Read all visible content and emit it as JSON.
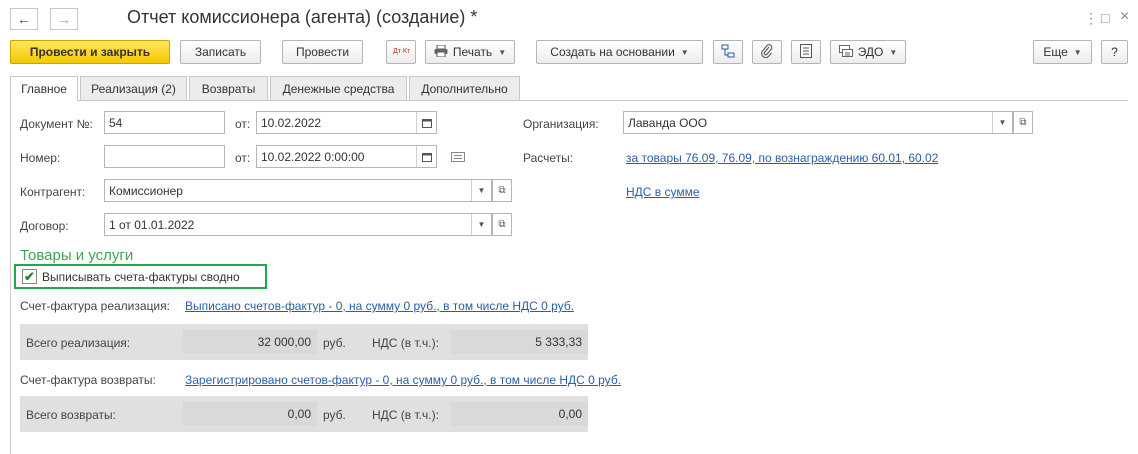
{
  "window": {
    "title": "Отчет комиссионера (агента) (создание) *",
    "back_icon": "←",
    "forward_icon": "→",
    "menu_icon": "⋮",
    "maximize_icon": "□",
    "close_icon": "×"
  },
  "toolbar": {
    "post_close": "Провести и закрыть",
    "save": "Записать",
    "post": "Провести",
    "dtkt": "Дт Кт",
    "print": "Печать",
    "create_based": "Создать на основании",
    "edo": "ЭДО",
    "more": "Еще",
    "help": "?"
  },
  "tabs": [
    {
      "label": "Главное"
    },
    {
      "label": "Реализация (2)"
    },
    {
      "label": "Возвраты"
    },
    {
      "label": "Денежные средства"
    },
    {
      "label": "Дополнительно"
    }
  ],
  "form": {
    "doc_no_label": "Документ №:",
    "doc_no_value": "54",
    "from_label": "от:",
    "doc_date": "10.02.2022",
    "number_label": "Номер:",
    "number_value": "",
    "datetime": "10.02.2022  0:00:00",
    "counterparty_label": "Контрагент:",
    "counterparty_value": "Комиссионер",
    "contract_label": "Договор:",
    "contract_value": "1 от 01.01.2022",
    "org_label": "Организация:",
    "org_value": "Лаванда ООО",
    "settlements_label": "Расчеты:",
    "settlements_link": "за товары 76.09, 76.09, по вознаграждению 60.01, 60.02",
    "vat_link": "НДС в сумме"
  },
  "goods": {
    "section_title": "Товары и услуги",
    "checkbox_label": "Выписывать счета-фактуры сводно",
    "checkbox_checked": true,
    "invoice_sales_label": "Счет-фактура реализация:",
    "invoice_sales_link": "Выписано счетов-фактур - 0, на сумму 0 руб., в том числе НДС 0 руб.",
    "total_sales_label": "Всего реализация:",
    "total_sales_value": "32 000,00",
    "currency1": "руб.",
    "vat_incl_label1": "НДС (в т.ч.):",
    "vat_sales_value": "5 333,33",
    "invoice_returns_label": "Счет-фактура возвраты:",
    "invoice_returns_link": "Зарегистрировано счетов-фактур - 0, на сумму 0 руб., в том числе НДС 0 руб.",
    "total_returns_label": "Всего возвраты:",
    "total_returns_value": "0,00",
    "currency2": "руб.",
    "vat_incl_label2": "НДС (в т.ч.):",
    "vat_returns_value": "0,00"
  }
}
